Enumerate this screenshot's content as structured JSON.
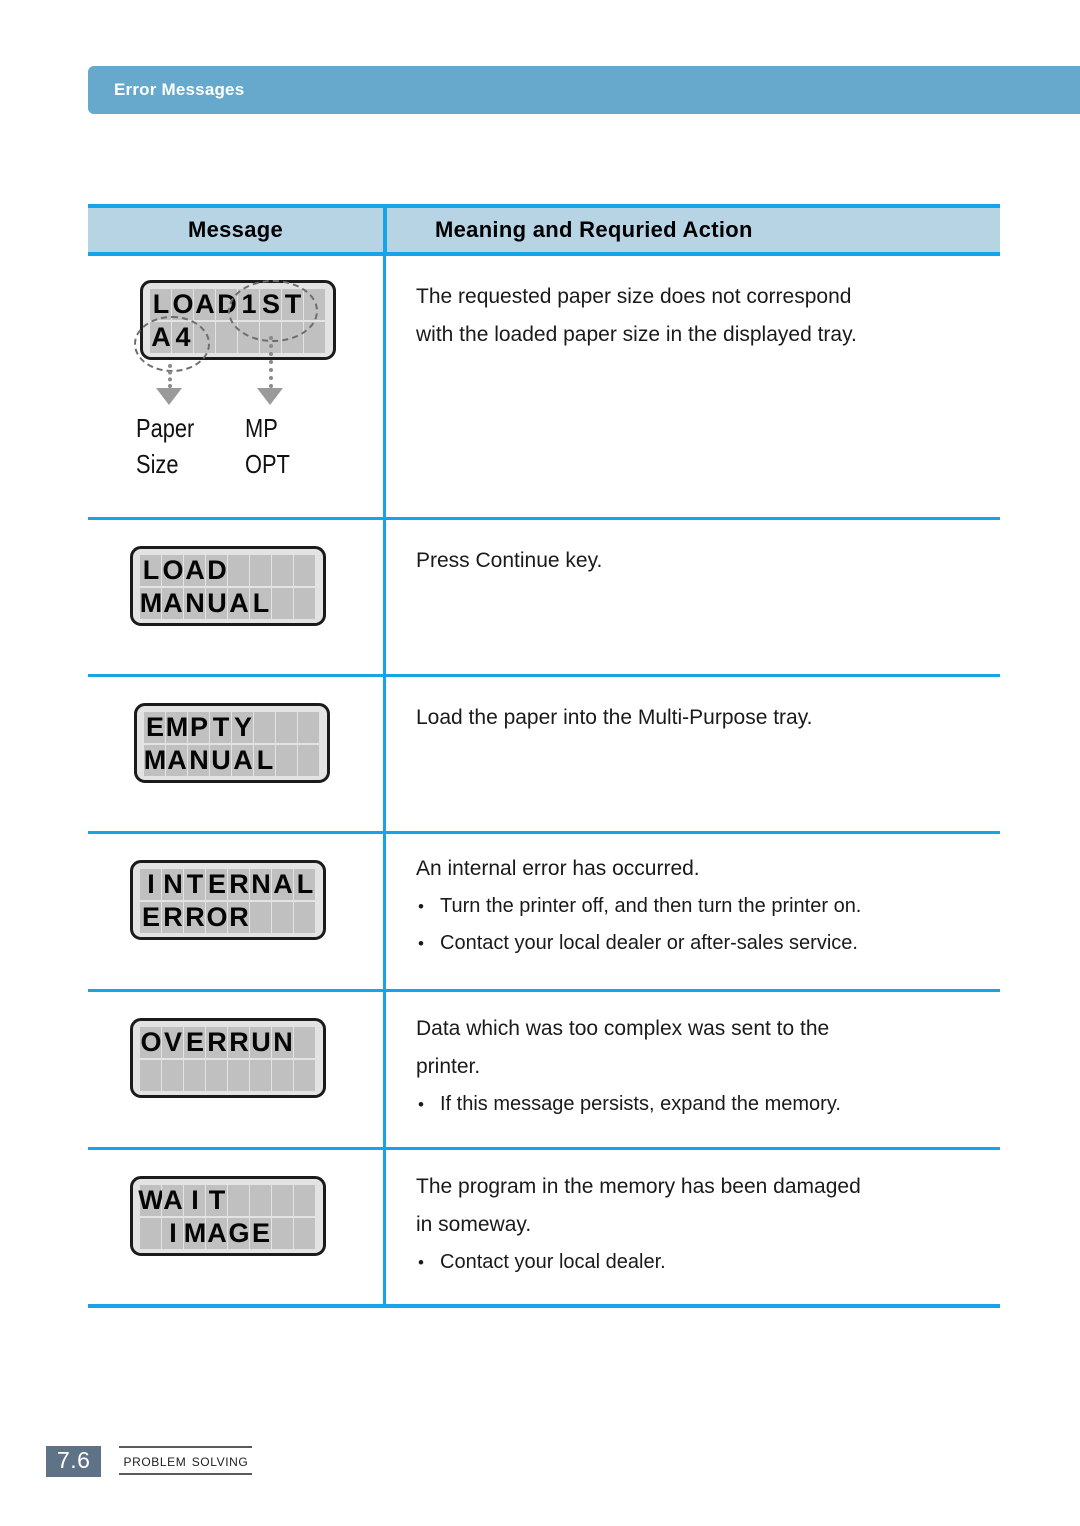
{
  "header": {
    "title": "Error Messages",
    "bar_color": "#66a9cc"
  },
  "table": {
    "columns": [
      "Message",
      "Meaning and Requried Action"
    ],
    "border_color": "#17a3e8",
    "header_bg": "#b6d4e3",
    "rows": [
      {
        "id": "load-1st-a4",
        "lcd": {
          "line1": "LOAD1ST",
          "line2": "A4",
          "cells": 8
        },
        "callouts": [
          {
            "label_line1": "Paper",
            "label_line2": "Size",
            "target": "A4"
          },
          {
            "label_line1": "MP",
            "label_line2": "OPT",
            "target": "1ST"
          }
        ],
        "meaning_lines": [
          "The requested paper size does not correspond",
          "with the loaded paper size in the displayed tray."
        ],
        "bullets": []
      },
      {
        "id": "load-manual",
        "lcd": {
          "line1": "LOAD",
          "line2": "MANUAL",
          "cells": 8
        },
        "callouts": [],
        "meaning_lines": [
          "Press Continue key."
        ],
        "bullets": []
      },
      {
        "id": "empty-manual",
        "lcd": {
          "line1": "EMPTY",
          "line2": "MANUAL",
          "cells": 8
        },
        "callouts": [],
        "meaning_lines": [
          "Load the paper into the Multi-Purpose tray."
        ],
        "bullets": []
      },
      {
        "id": "internal-error",
        "lcd": {
          "line1": "INTERNAL",
          "line2": "ERROR",
          "cells": 8
        },
        "callouts": [],
        "meaning_lines": [
          "An internal error has occurred."
        ],
        "bullets": [
          "Turn the printer off, and then turn the printer on.",
          "Contact your local dealer or after-sales service."
        ]
      },
      {
        "id": "overrun",
        "lcd": {
          "line1": "OVERRUN",
          "line2": "",
          "cells": 8
        },
        "callouts": [],
        "meaning_lines": [
          "Data which was too complex was sent to the",
          "printer."
        ],
        "bullets": [
          "If this message persists, expand the memory."
        ]
      },
      {
        "id": "wait-image",
        "lcd": {
          "line1": "WAIT",
          "line2": " IMAGE",
          "cells": 8
        },
        "callouts": [],
        "meaning_lines": [
          "The program in the memory has been damaged",
          "in someway."
        ],
        "bullets": [
          "Contact your local dealer."
        ]
      }
    ]
  },
  "footer": {
    "page_number": "7.6",
    "section": "Problem Solving",
    "page_badge_color": "#5f7387"
  }
}
